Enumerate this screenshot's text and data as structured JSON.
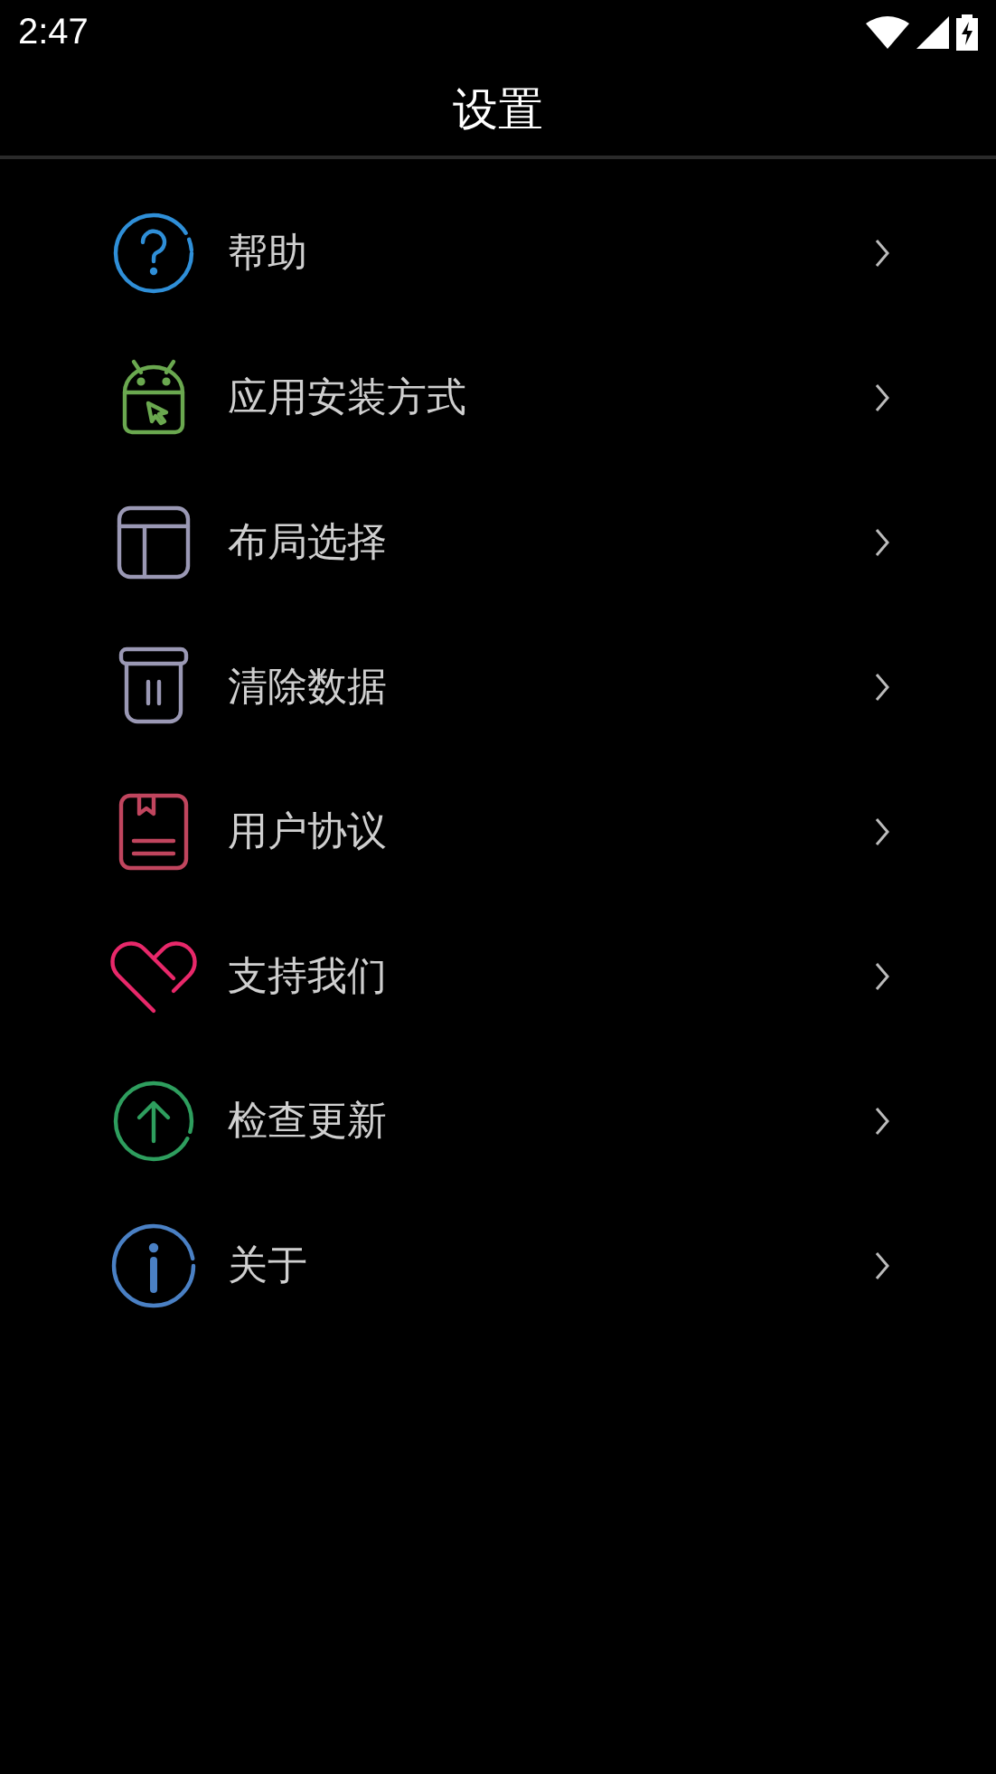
{
  "status_bar": {
    "time": "2:47"
  },
  "title": "设置",
  "items": [
    {
      "label": "帮助",
      "kind": "help",
      "color": "#2f8fd8"
    },
    {
      "label": "应用安装方式",
      "kind": "android",
      "color": "#6aa84f"
    },
    {
      "label": "布局选择",
      "kind": "layout",
      "color": "#9a98b4"
    },
    {
      "label": "清除数据",
      "kind": "trash",
      "color": "#9a98b4"
    },
    {
      "label": "用户协议",
      "kind": "doc",
      "color": "#c0455e"
    },
    {
      "label": "支持我们",
      "kind": "heart",
      "color": "#e8286a"
    },
    {
      "label": "检查更新",
      "kind": "update",
      "color": "#2e9e5e"
    },
    {
      "label": "关于",
      "kind": "info",
      "color": "#4a80c4"
    }
  ]
}
